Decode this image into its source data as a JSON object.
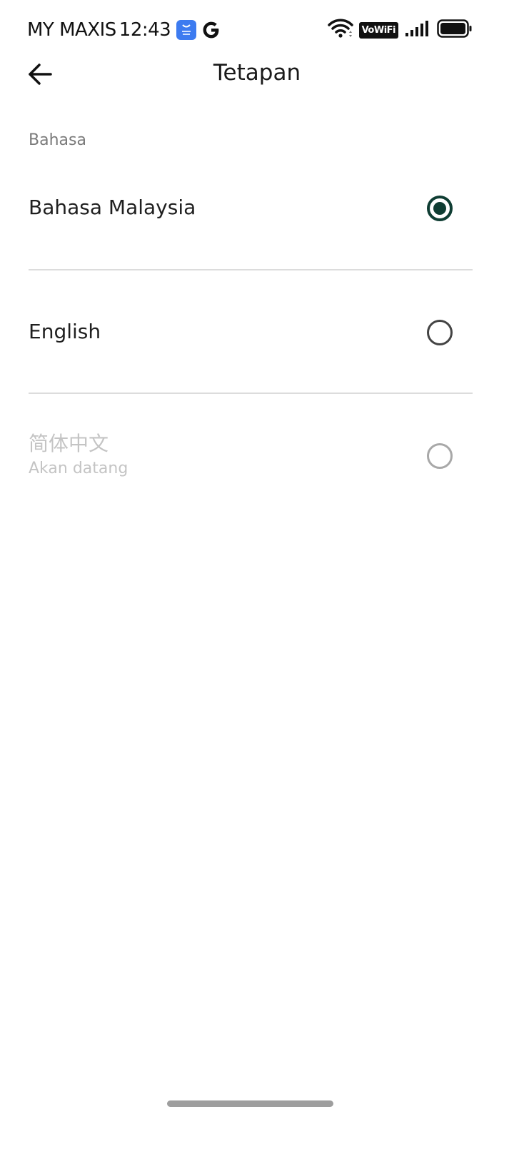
{
  "status_bar": {
    "carrier": "MY MAXIS",
    "time": "12:43",
    "vowifi": "VoWiFi",
    "icons": [
      "app-store-icon",
      "google-icon",
      "wifi-icon",
      "vowifi-icon",
      "signal-icon",
      "battery-icon"
    ]
  },
  "header": {
    "title": "Tetapan",
    "back_icon": "arrow-left-icon"
  },
  "section": {
    "label": "Bahasa"
  },
  "options": [
    {
      "label": "Bahasa Malaysia",
      "selected": true,
      "enabled": true
    },
    {
      "label": "English",
      "selected": false,
      "enabled": true
    },
    {
      "label": "简体中文",
      "sublabel": "Akan datang",
      "selected": false,
      "enabled": false
    }
  ],
  "colors": {
    "accent": "#0f3d33",
    "divider": "#dcdcdc",
    "disabled_text": "#c4c4c4",
    "section_label": "#7a7a7a"
  }
}
